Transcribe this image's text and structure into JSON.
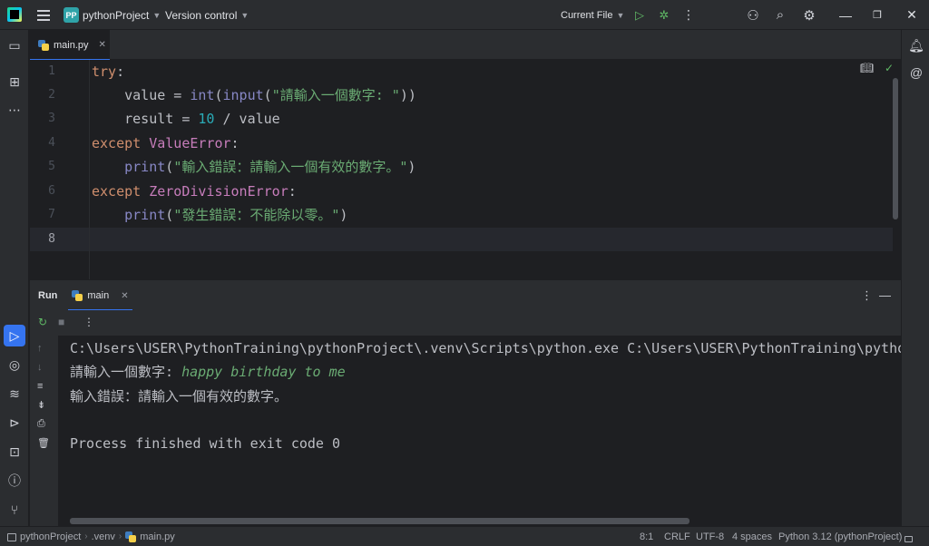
{
  "titlebar": {
    "project_badge": "PP",
    "project_name": "pythonProject",
    "version_control": "Version control",
    "run_config": "Current File"
  },
  "editor_tab": {
    "label": "main.py"
  },
  "editor": {
    "line_numbers": [
      "1",
      "2",
      "3",
      "4",
      "5",
      "6",
      "7",
      "8"
    ],
    "current_line": 8
  },
  "run_panel": {
    "title": "Run",
    "tab_label": "main"
  },
  "console": {
    "command": "C:\\Users\\USER\\PythonTraining\\pythonProject\\.venv\\Scripts\\python.exe C:\\Users\\USER\\PythonTraining\\pythonProject\\main.py",
    "prompt": "請輸入一個數字: ",
    "user_input": "happy birthday to me",
    "error_output": "輸入錯誤：請輸入一個有效的數字。",
    "finish_message": "Process finished with exit code 0"
  },
  "statusbar": {
    "breadcrumb_project": "pythonProject",
    "breadcrumb_folder": ".venv",
    "breadcrumb_file": "main.py",
    "position": "8:1",
    "line_ending": "CRLF",
    "encoding": "UTF-8",
    "indent": "4 spaces",
    "interpreter": "Python 3.12 (pythonProject)"
  }
}
